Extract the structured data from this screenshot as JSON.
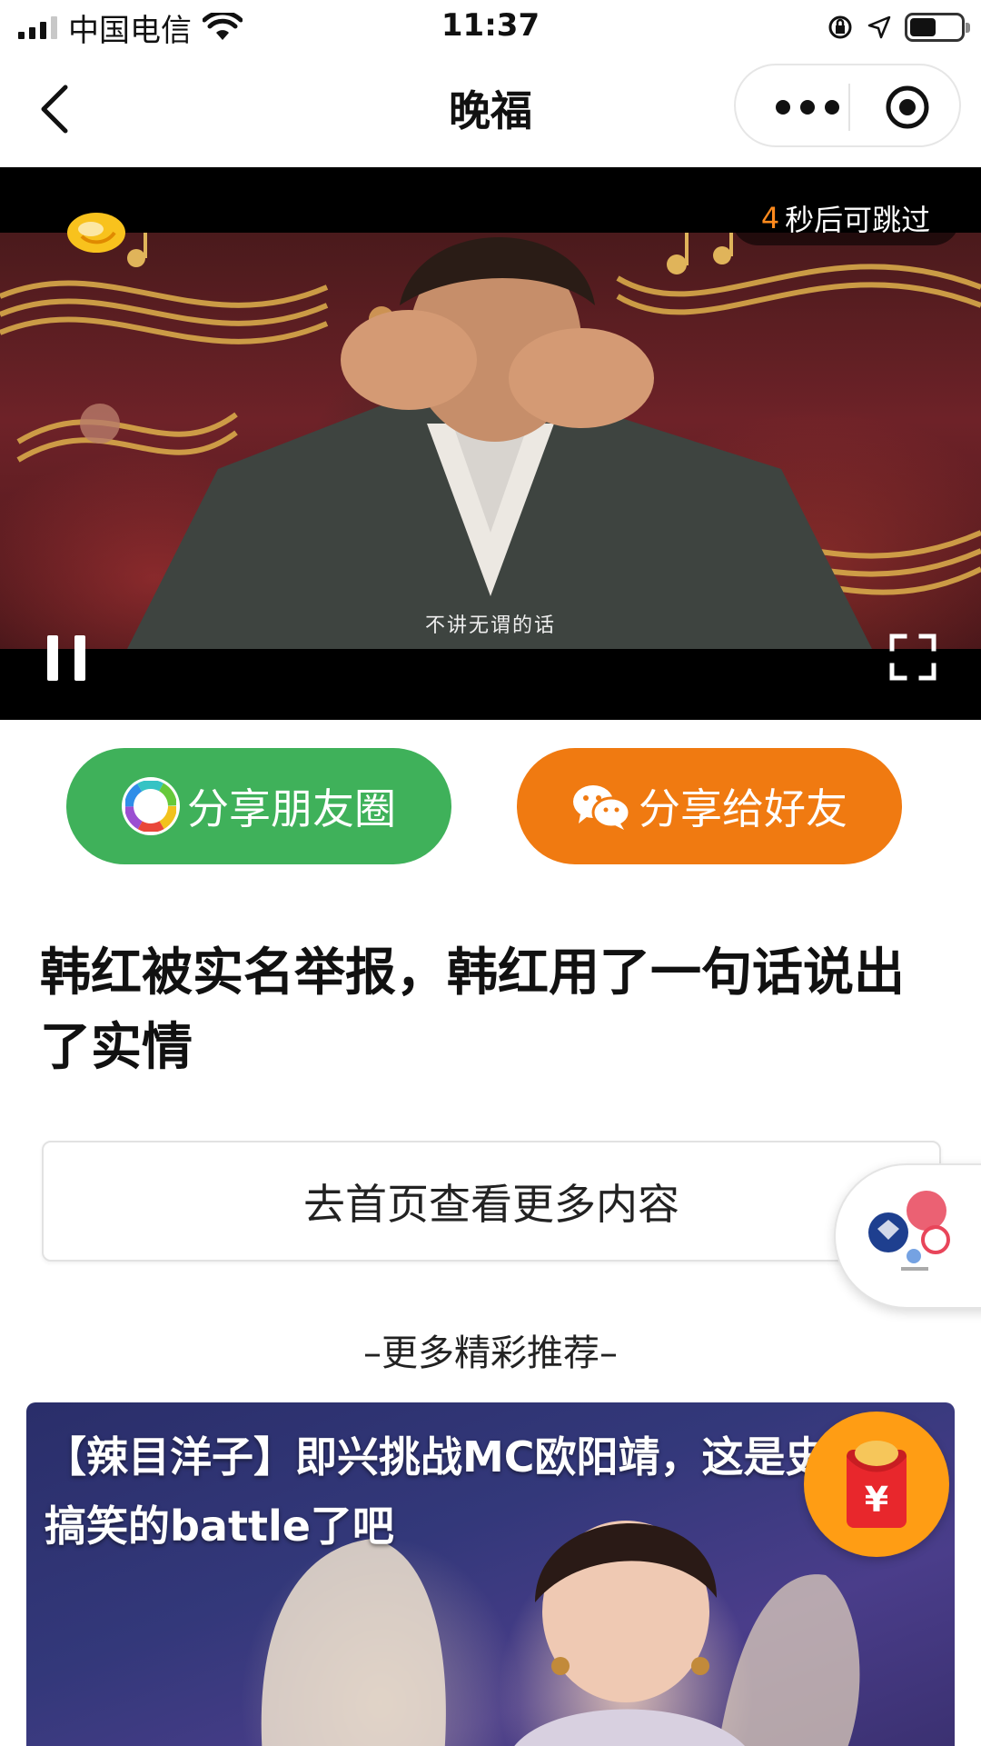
{
  "status_bar": {
    "carrier": "中国电信",
    "time": "11:37"
  },
  "nav": {
    "title": "晚福"
  },
  "video": {
    "skip_countdown": "4",
    "skip_text": "秒后可跳过",
    "subtitle": "不讲无谓的话",
    "state": "playing"
  },
  "share": {
    "moments_label": "分享朋友圈",
    "friend_label": "分享给好友",
    "moments_color": "#3fb15a",
    "friend_color": "#f07a11"
  },
  "article": {
    "headline": "韩红被实名举报，韩红用了一句话说出了实情",
    "home_button": "去首页查看更多内容"
  },
  "recommend": {
    "section_label": "–更多精彩推荐–",
    "items": [
      {
        "title": "【辣目洋子】即兴挑战MC欧阳靖，这是史上最搞笑的battle了吧"
      }
    ]
  },
  "floating": {
    "red_packet_symbol": "¥"
  }
}
